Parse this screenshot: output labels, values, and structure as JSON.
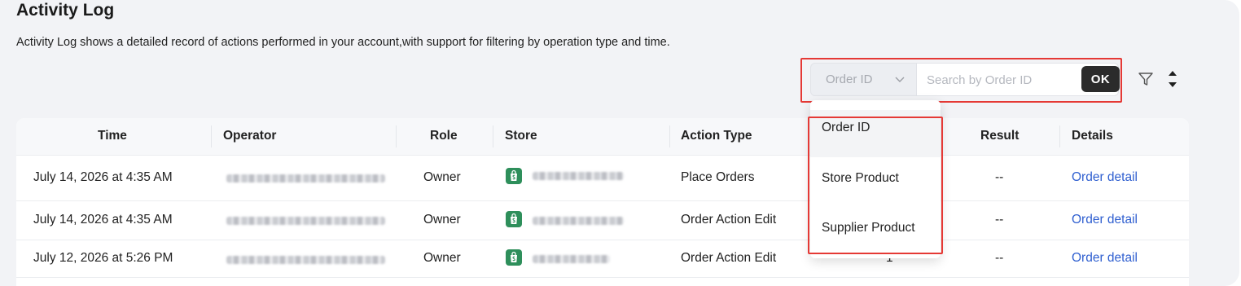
{
  "header": {
    "title": "Activity Log",
    "description": "Activity Log shows a detailed record of actions performed in your account,with support for filtering by operation type and time."
  },
  "search": {
    "field_selected": "Order ID",
    "placeholder": "Search by Order ID",
    "value": "",
    "ok_label": "OK"
  },
  "dropdown": {
    "options": [
      {
        "label": "Order ID",
        "selected": true
      },
      {
        "label": "Store Product",
        "selected": false
      },
      {
        "label": "Supplier Product",
        "selected": false
      }
    ]
  },
  "table": {
    "columns": [
      "Time",
      "Operator",
      "Role",
      "Store",
      "Action Type",
      "Result",
      "Details"
    ],
    "rows": [
      {
        "time": "July 14, 2026 at 4:35 AM",
        "role": "Owner",
        "action": "Place Orders",
        "result": "--",
        "details": "Order detail"
      },
      {
        "time": "July 14, 2026 at 4:35 AM",
        "role": "Owner",
        "action": "Order Action Edit",
        "result": "--",
        "details": "Order detail"
      },
      {
        "time": "July 12, 2026 at 5:26 PM",
        "role": "Owner",
        "action": "Order Action Edit",
        "result": "--",
        "details": "Order detail",
        "partial_hidden": "1"
      }
    ]
  },
  "icons": {
    "select": "chevron-down-icon",
    "filter": "filter-icon",
    "sort": "sort-icon",
    "store": "shopify-bag-icon"
  },
  "colors": {
    "highlight": "#e53935",
    "link": "#2f5fd0",
    "ok_button": "#2b2b2b",
    "store_icon": "#2e8f5b",
    "page_bg": "#f2f3f6"
  }
}
